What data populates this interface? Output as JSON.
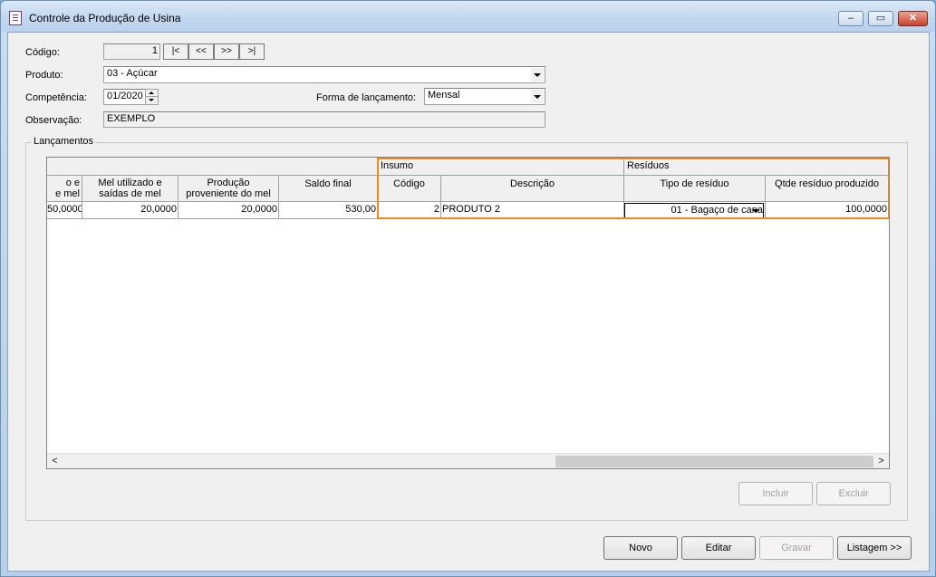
{
  "window": {
    "title": "Controle da Produção de Usina",
    "controls": [
      "‒",
      "▭",
      "✕"
    ]
  },
  "form": {
    "codigo_label": "Código:",
    "codigo_value": "1",
    "nav_buttons": [
      "|<",
      "<<",
      ">>",
      ">|"
    ],
    "produto_label": "Produto:",
    "produto_value": "03 - Açúcar",
    "competencia_label": "Competência:",
    "competencia_value": "01/2020",
    "forma_label": "Forma de lançamento:",
    "forma_value": "Mensal",
    "observacao_label": "Observação:",
    "observacao_value": "EXEMPLO"
  },
  "lancamentos": {
    "group_title": "Lançamentos",
    "group_headers": {
      "insumo": "Insumo",
      "residuos": "Resíduos"
    },
    "columns": [
      "o e\ne mel",
      "Mel utilizado e\nsaídas de mel",
      "Produção\nproveniente do mel",
      "Saldo final",
      "Código",
      "Descrição",
      "Tipo de resíduo",
      "Qtde resíduo produzido"
    ],
    "rows": [
      {
        "c0": "50,0000",
        "c1": "20,0000",
        "c2": "20,0000",
        "c3": "530,00",
        "c4": "2",
        "c5": "PRODUTO 2",
        "c6": "01 - Bagaço de cana",
        "c7": "100,0000"
      }
    ],
    "scroll_left": "<",
    "scroll_right": ">",
    "incluir_label": "Incluir",
    "excluir_label": "Excluir"
  },
  "footer": {
    "novo_label": "Novo",
    "editar_label": "Editar",
    "gravar_label": "Gravar",
    "listagem_label": "Listagem >>"
  },
  "colors": {
    "highlight": "#f08a1f",
    "title_bar": "#c4d9f0"
  }
}
